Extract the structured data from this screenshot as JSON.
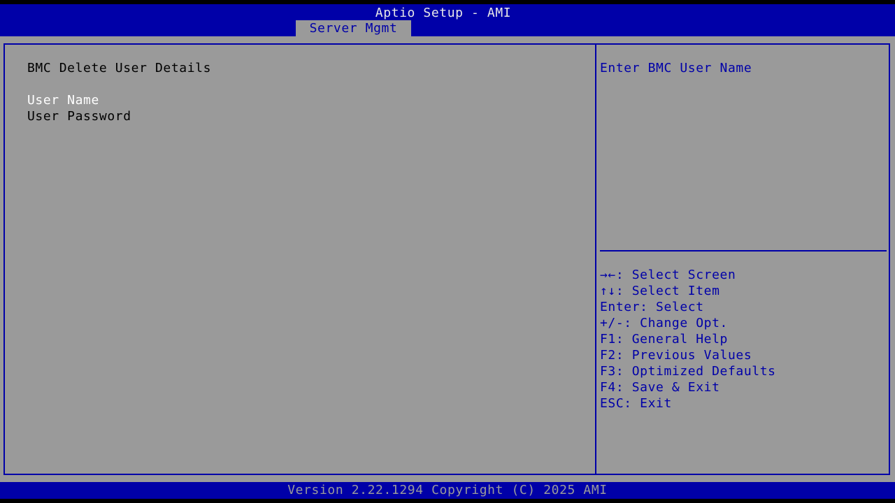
{
  "header": {
    "title": "Aptio Setup - AMI",
    "tab": "Server Mgmt"
  },
  "main": {
    "heading": "BMC Delete User Details",
    "items": [
      {
        "label": "User Name"
      },
      {
        "label": "User Password"
      }
    ]
  },
  "help": {
    "text": "Enter BMC User Name"
  },
  "keys": [
    "→←: Select Screen",
    "↑↓: Select Item",
    "Enter: Select",
    "+/-: Change Opt.",
    "F1: General Help",
    "F2: Previous Values",
    "F3: Optimized Defaults",
    "F4: Save & Exit",
    "ESC: Exit"
  ],
  "footer": {
    "text": "Version 2.22.1294 Copyright (C) 2025 AMI"
  },
  "colors": {
    "background": "#9a9a9a",
    "accent": "#0000a8",
    "selected_text": "#ffffff",
    "text": "#000000"
  }
}
